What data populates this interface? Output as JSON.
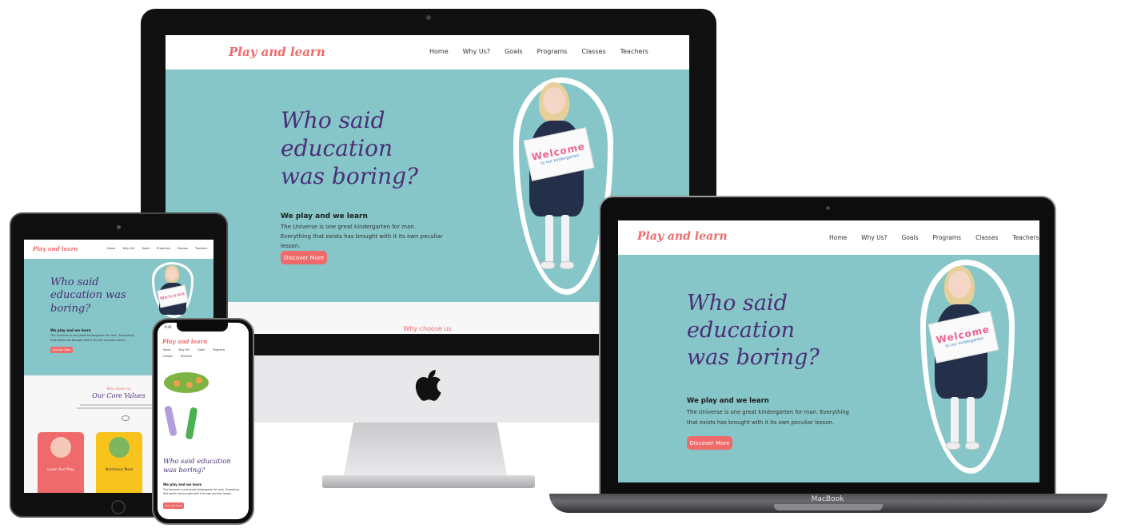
{
  "brand": {
    "logo": "Play and learn",
    "accent": "#ef6a6a",
    "hero_bg": "#86c5c8",
    "headline_color": "#4a2f78"
  },
  "nav": [
    "Home",
    "Why Us?",
    "Goals",
    "Programs",
    "Classes",
    "Teachers"
  ],
  "hero": {
    "headline": "Who said education was boring?",
    "subheading": "We play and we learn",
    "paragraph": "The Universe is one great kindergarten for man. Everything that exists has brought with it its own peculiar lesson.",
    "button": "Discover More"
  },
  "sign": {
    "title": "Welcome",
    "caption": "to our kindergarten"
  },
  "why_section": {
    "heading": "Why choose us"
  },
  "tablet": {
    "section_kicker": "Why choose us",
    "section_title": "Our Core Values",
    "cards": [
      {
        "title": "Learn And Play",
        "color": "#ef6a6a"
      },
      {
        "title": "Nutritious Meal",
        "color": "#f7c31c"
      }
    ]
  },
  "phone": {
    "time": "9:41"
  },
  "devices": {
    "macbook_label": "MacBook"
  },
  "icons": [
    "apple-logo-icon",
    "camera-icon",
    "home-button-icon"
  ]
}
